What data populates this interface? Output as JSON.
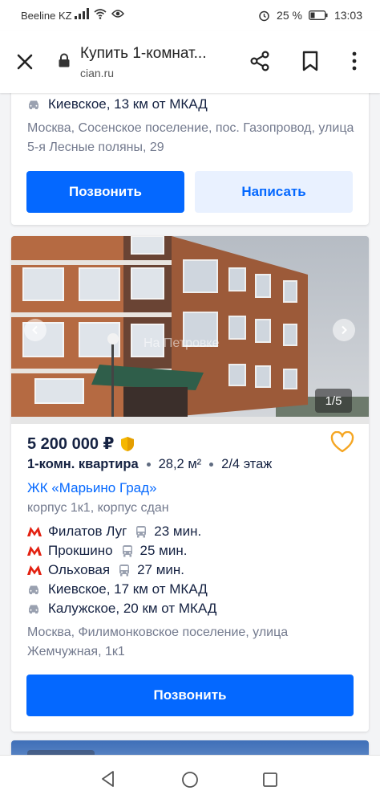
{
  "status_bar": {
    "carrier": "Beeline KZ",
    "battery": "25 %",
    "time": "13:03"
  },
  "browser": {
    "title": "Купить 1-комнат...",
    "url": "cian.ru"
  },
  "listing_top": {
    "highway": "Киевское, 13 км от МКАД",
    "address": "Москва, Сосенское поселение, пос. Газопровод, улица 5-я Лесные поляны, 29",
    "call_button": "Позвонить",
    "message_button": "Написать"
  },
  "listing_main": {
    "photo_counter": "1/5",
    "photo_watermark": "На Петровке",
    "price": "5 200 000 ₽",
    "rooms": "1-комн. квартира",
    "area": "28,2 м²",
    "floor": "2/4 этаж",
    "complex": "ЖК «Марьино Град»",
    "building": "корпус 1к1, корпус сдан",
    "metro": [
      {
        "station": "Филатов Луг",
        "time": "23 мин."
      },
      {
        "station": "Прокшино",
        "time": "25 мин."
      },
      {
        "station": "Ольховая",
        "time": "27 мин."
      }
    ],
    "highways": [
      "Киевское, 17 км от МКАД",
      "Калужское, 20 км от МКАД"
    ],
    "address": "Москва, Филимонковское поселение, улица Жемчужная, 1к1",
    "call_button": "Позвонить"
  },
  "colors": {
    "accent": "#0468ff",
    "metro_red": "#e32212",
    "favorite": "#f5a623"
  }
}
